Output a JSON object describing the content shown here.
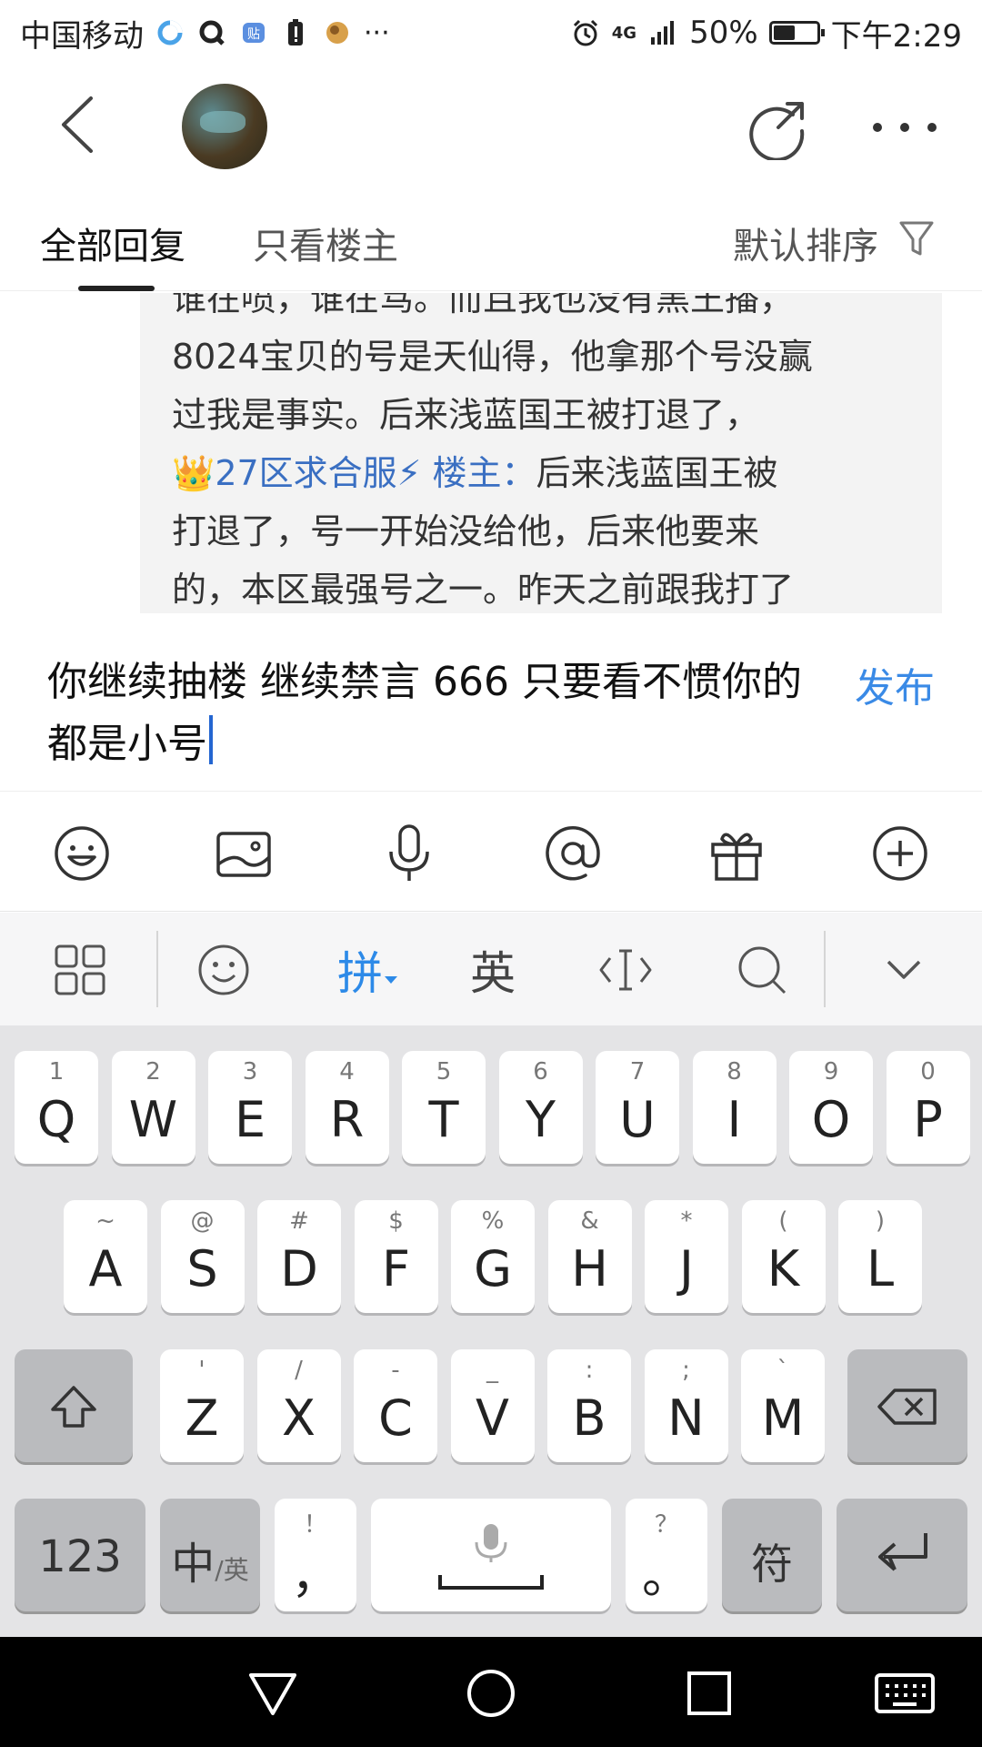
{
  "status_bar": {
    "carrier": "中国移动",
    "network": "4G",
    "battery_percent_text": "50%",
    "battery_level": 0.5,
    "time": "下午2:29"
  },
  "header": {
    "icons": [
      "back-icon",
      "avatar",
      "share-icon",
      "more-icon"
    ]
  },
  "tabs": {
    "all_replies": "全部回复",
    "only_op": "只看楼主",
    "sort_label": "默认排序"
  },
  "post": {
    "line1": "谁在喷，谁在骂。而且我也没有黑王播，",
    "line2": "8024宝贝的号是天仙得，他拿那个号没赢",
    "line3": "过我是事实。后来浅蓝国王被打退了，",
    "line4_user": "👑27区求合服⚡",
    "line4_role": "楼主：",
    "line4_text": "后来浅蓝国王被",
    "line5": "打退了，号一开始没给他，后来他要来",
    "line6": "的，本区最强号之一。昨天之前跟我打了"
  },
  "reply": {
    "text": "你继续抽楼 继续禁言 666 只要看不惯你的都是小号",
    "publish_label": "发布"
  },
  "ime": {
    "pinyin_label": "拼",
    "english_label": "英"
  },
  "keyboard": {
    "row1": [
      {
        "k": "Q",
        "s": "1"
      },
      {
        "k": "W",
        "s": "2"
      },
      {
        "k": "E",
        "s": "3"
      },
      {
        "k": "R",
        "s": "4"
      },
      {
        "k": "T",
        "s": "5"
      },
      {
        "k": "Y",
        "s": "6"
      },
      {
        "k": "U",
        "s": "7"
      },
      {
        "k": "I",
        "s": "8"
      },
      {
        "k": "O",
        "s": "9"
      },
      {
        "k": "P",
        "s": "0"
      }
    ],
    "row2": [
      {
        "k": "A",
        "s": "~"
      },
      {
        "k": "S",
        "s": "@"
      },
      {
        "k": "D",
        "s": "#"
      },
      {
        "k": "F",
        "s": "$"
      },
      {
        "k": "G",
        "s": "%"
      },
      {
        "k": "H",
        "s": "&"
      },
      {
        "k": "J",
        "s": "*"
      },
      {
        "k": "K",
        "s": "("
      },
      {
        "k": "L",
        "s": ")"
      }
    ],
    "row3": [
      {
        "k": "Z",
        "s": "'"
      },
      {
        "k": "X",
        "s": "/"
      },
      {
        "k": "C",
        "s": "-"
      },
      {
        "k": "V",
        "s": "_"
      },
      {
        "k": "B",
        "s": ":"
      },
      {
        "k": "N",
        "s": ";"
      },
      {
        "k": "M",
        "s": "`"
      }
    ],
    "num_label": "123",
    "cn_label": "中",
    "cn_sub": "/英",
    "comma_main": "，",
    "comma_sub": "！",
    "period_main": "。",
    "period_sub": "？",
    "symbol_label": "符"
  },
  "colors": {
    "accent_blue": "#3a8ae6",
    "link_blue": "#3a6fc2",
    "caret": "#2466d1"
  }
}
